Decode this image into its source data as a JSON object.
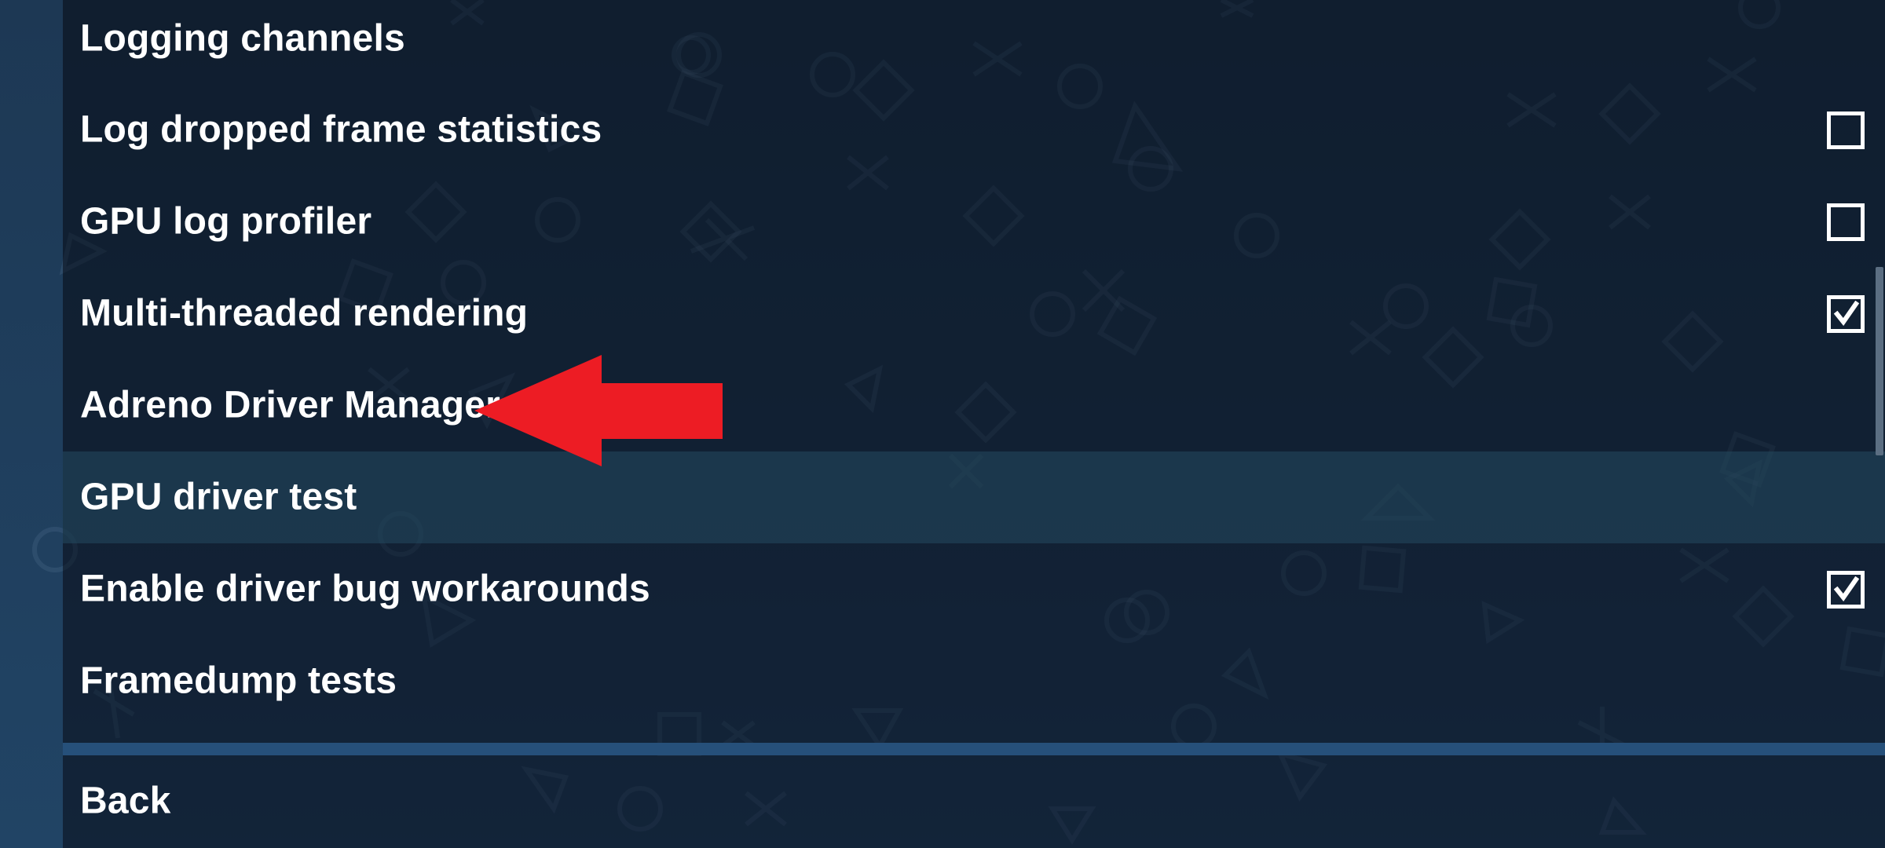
{
  "settings": {
    "rows": [
      {
        "label": "Logging channels",
        "checkbox": "none"
      },
      {
        "label": "Log dropped frame statistics",
        "checkbox": "unchecked"
      },
      {
        "label": "GPU log profiler",
        "checkbox": "unchecked"
      },
      {
        "label": "Multi-threaded rendering",
        "checkbox": "checked"
      },
      {
        "label": "Adreno Driver Manager",
        "checkbox": "none"
      },
      {
        "label": "GPU driver test",
        "checkbox": "none",
        "highlighted": true
      },
      {
        "label": "Enable driver bug workarounds",
        "checkbox": "checked"
      },
      {
        "label": "Framedump tests",
        "checkbox": "none"
      }
    ],
    "back_label": "Back"
  },
  "annotation": {
    "arrow_color": "#ed1c24",
    "arrow_points_to": "Adreno Driver Manager"
  },
  "colors": {
    "text": "#ffffff",
    "highlight_row": "#1e3d52",
    "divider": "#26507a"
  }
}
